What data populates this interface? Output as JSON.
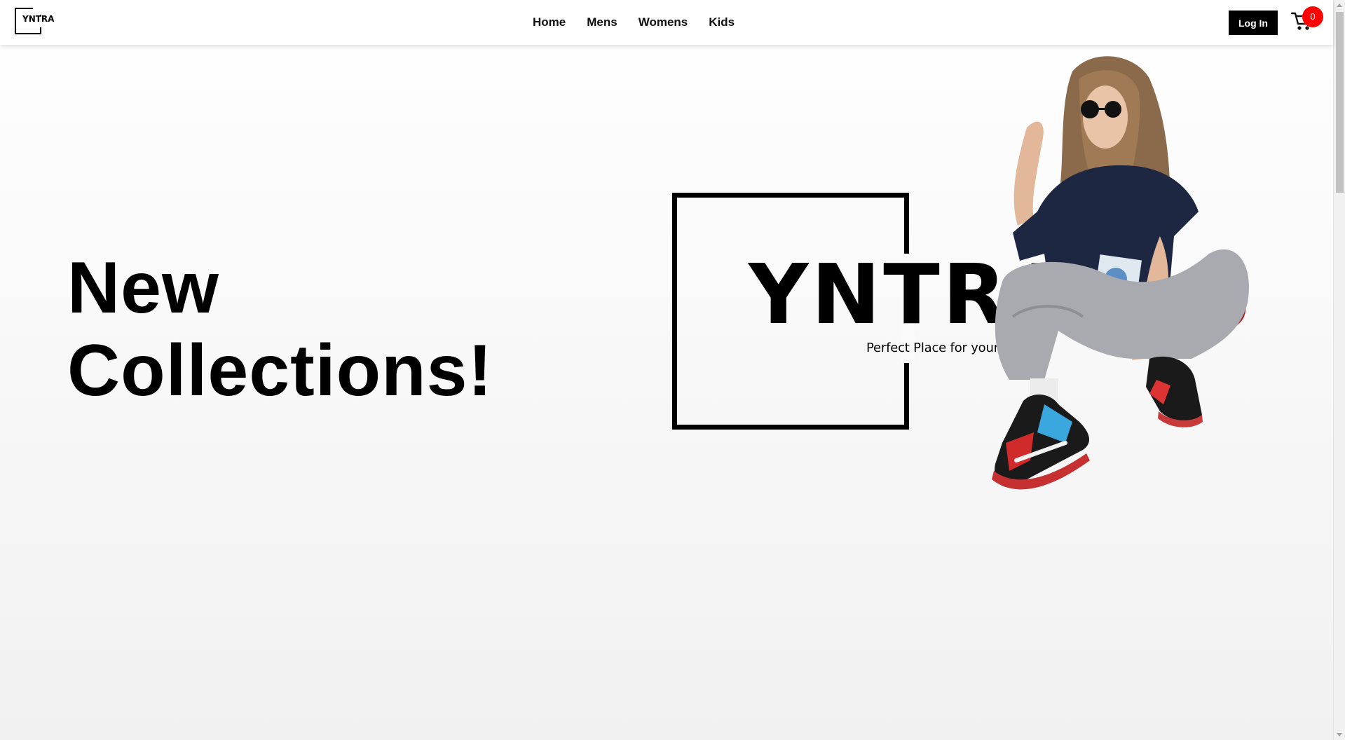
{
  "header": {
    "logo_text": "YNTRA",
    "nav": [
      "Home",
      "Mens",
      "Womens",
      "Kids"
    ],
    "login_label": "Log In",
    "cart_count": "0"
  },
  "hero": {
    "title_line1": "New",
    "title_line2": "Collections!",
    "brand_name": "YNTRA",
    "brand_tagline": "Perfect Place for your Fashion"
  },
  "colors": {
    "accent": "#000000",
    "badge": "#ff0000",
    "background": "#f4f4f4"
  },
  "icons": {
    "cart": "cart-icon"
  }
}
